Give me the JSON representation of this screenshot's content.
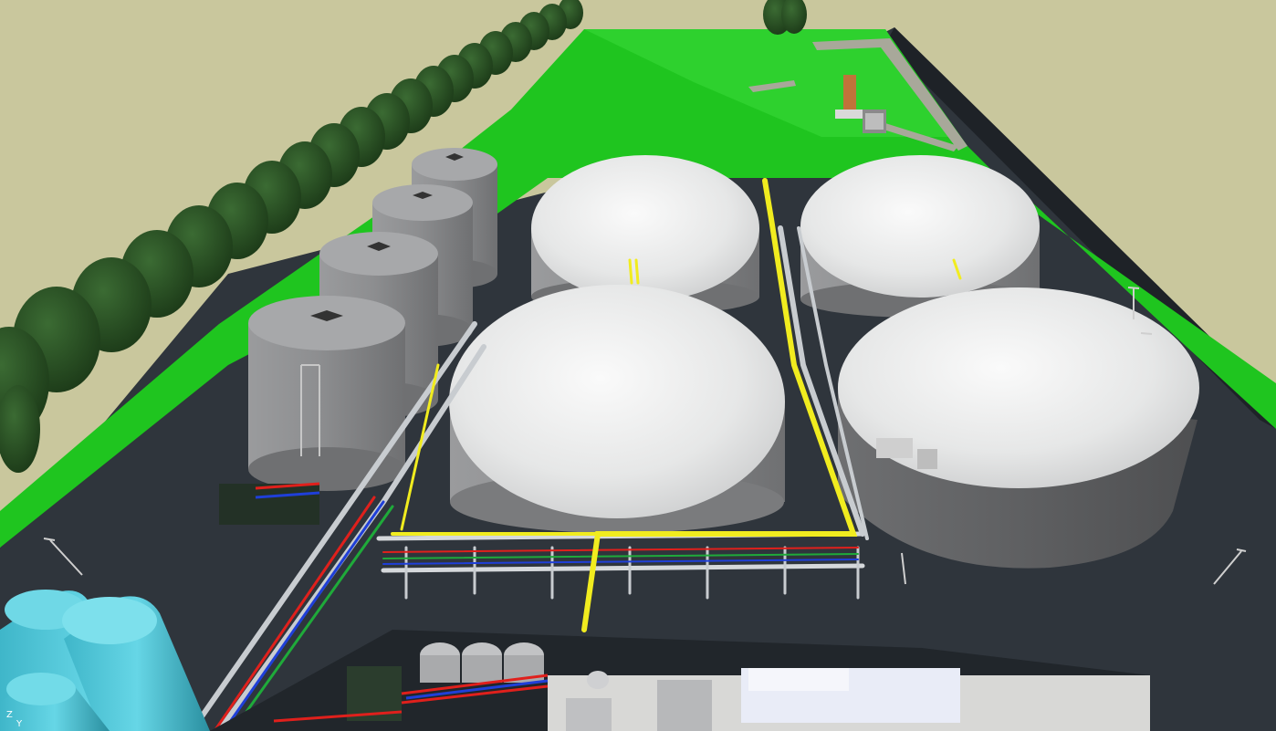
{
  "viewport": {
    "background": "#c9c79d",
    "colors": {
      "ground": "#c9c79d",
      "grass": "#1fc51f",
      "asphalt": "#2f353c",
      "tank_wall": "#8c8d8f",
      "dome": "#e9eaea",
      "yellow_pipe": "#f1ec1f",
      "red_pipe": "#e0201c",
      "blue_pipe": "#1f3fd8",
      "green_pipe": "#1faa3a",
      "trees": "#23451f",
      "storage_tanks": "#48c4d6"
    }
  },
  "axis_indicator": {
    "z_label": "Z",
    "y_label": "Y"
  }
}
